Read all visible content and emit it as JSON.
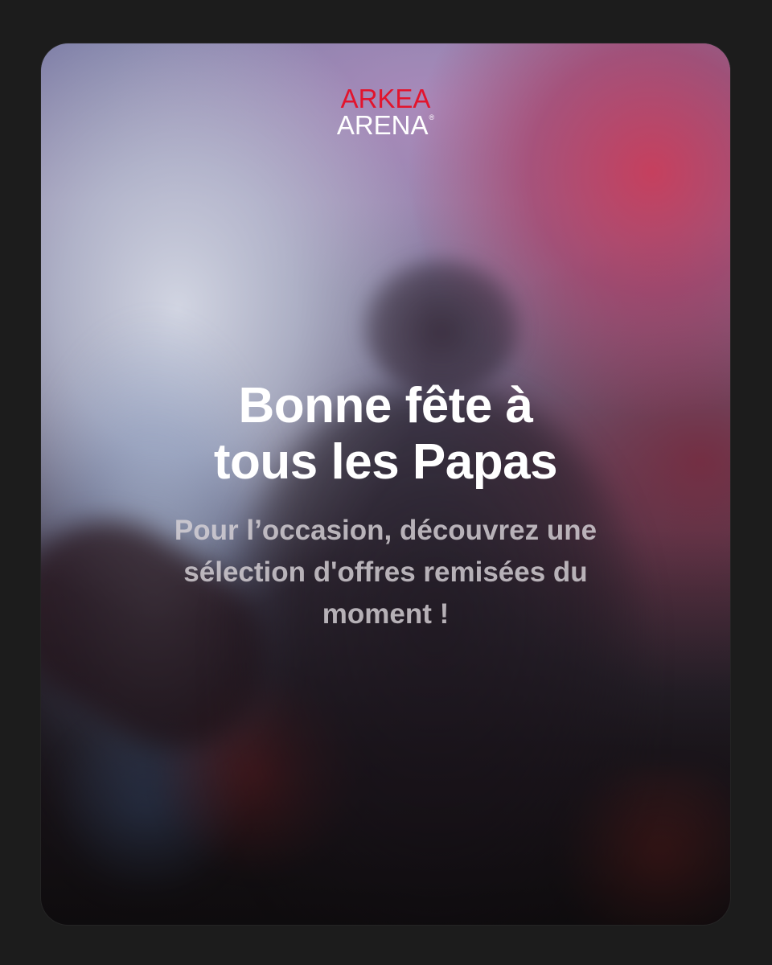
{
  "logo": {
    "line1": "ARKEA",
    "line2": "ARENA",
    "registered": "®"
  },
  "headline": {
    "line1": "Bonne fête à",
    "line2": "tous les Papas"
  },
  "subtitle": {
    "line1": "Pour l’occasion, découvrez une",
    "line2": "sélection d'offres remisées du",
    "line3": "moment !"
  },
  "colors": {
    "logo_accent": "#e2142d",
    "text_primary": "#ffffff",
    "page_background": "#1c1c1c"
  }
}
